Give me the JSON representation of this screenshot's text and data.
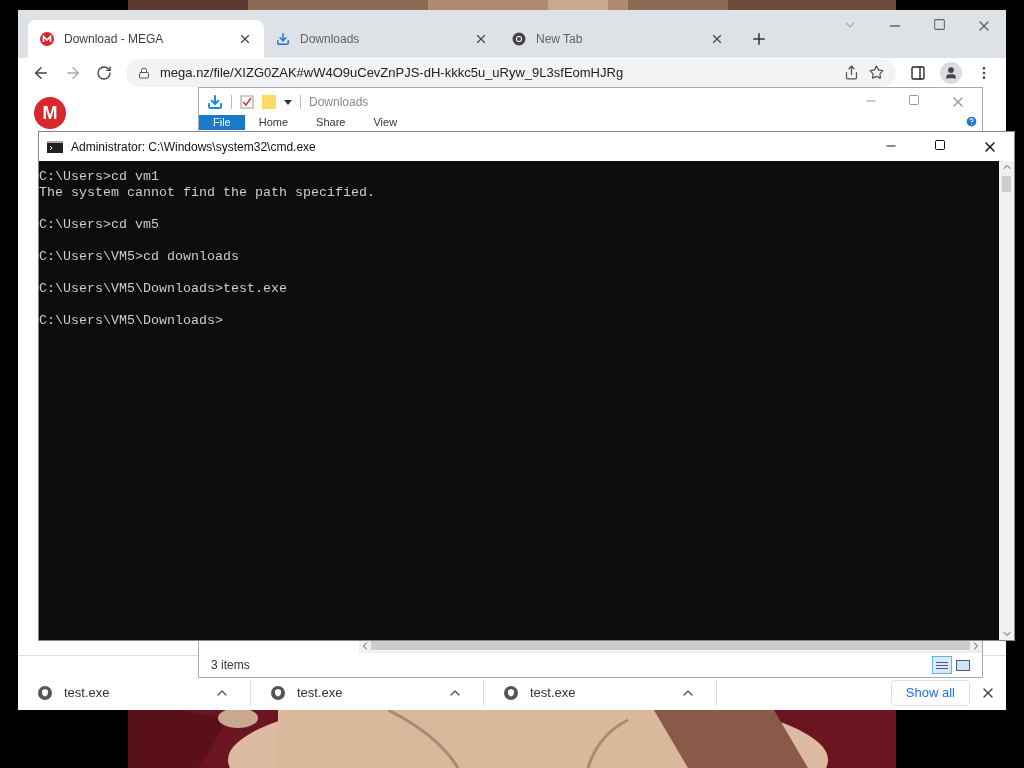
{
  "browser": {
    "tabs": [
      {
        "label": "Download - MEGA",
        "selected": true,
        "kind": "mega"
      },
      {
        "label": "Downloads",
        "selected": false,
        "kind": "download"
      },
      {
        "label": "New Tab",
        "selected": false,
        "kind": "chrome"
      }
    ],
    "address": "mega.nz/file/XIZG0ZAK#wW4O9uCevZnPJS-dH-kkkc5u_uRyw_9L3sfEomHJRg",
    "page_logo": "M",
    "downloads": [
      {
        "name": "test.exe"
      },
      {
        "name": "test.exe"
      },
      {
        "name": "test.exe"
      }
    ],
    "show_all": "Show all"
  },
  "explorer": {
    "title": "Downloads",
    "ribbon_tabs": [
      {
        "label": "File",
        "selected": true
      },
      {
        "label": "Home",
        "selected": false
      },
      {
        "label": "Share",
        "selected": false
      },
      {
        "label": "View",
        "selected": false
      }
    ],
    "status": "3 items"
  },
  "cmd": {
    "title": "Administrator: C:\\Windows\\system32\\cmd.exe",
    "blocks": [
      [
        "C:\\Users>cd vm1",
        "The system cannot find the path specified."
      ],
      [
        "C:\\Users>cd vm5"
      ],
      [
        "C:\\Users\\VM5>cd downloads"
      ],
      [
        "C:\\Users\\VM5\\Downloads>test.exe"
      ],
      [
        "C:\\Users\\VM5\\Downloads>"
      ]
    ]
  }
}
